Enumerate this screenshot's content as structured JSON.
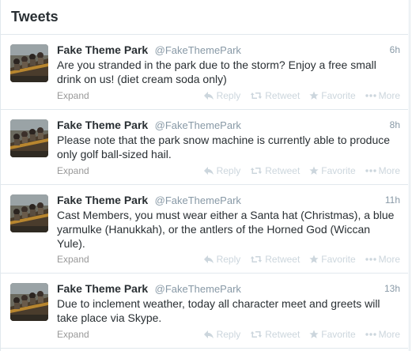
{
  "header": {
    "title": "Tweets"
  },
  "actions": {
    "reply": "Reply",
    "retweet": "Retweet",
    "favorite": "Favorite",
    "more": "More",
    "expand": "Expand"
  },
  "colors": {
    "text": "#292f33",
    "muted": "#8899a6",
    "action": "#ccd6dd",
    "divider": "#e1e8ed"
  },
  "tweets": [
    {
      "fullname": "Fake Theme Park",
      "username": "@FakeThemePark",
      "time": "6h",
      "text": "Are you stranded in the park due to the storm? Enjoy a free small drink on us! (diet cream soda only)"
    },
    {
      "fullname": "Fake Theme Park",
      "username": "@FakeThemePark",
      "time": "8h",
      "text": "Please note that the park snow machine is currently able to produce only golf ball-sized hail."
    },
    {
      "fullname": "Fake Theme Park",
      "username": "@FakeThemePark",
      "time": "11h",
      "text": "Cast Members, you must wear either a Santa hat (Christmas), a blue yarmulke (Hanukkah), or the antlers of the Horned God (Wiccan Yule)."
    },
    {
      "fullname": "Fake Theme Park",
      "username": "@FakeThemePark",
      "time": "13h",
      "text": "Due to inclement weather, today all character meet and greets will take place via Skype."
    }
  ]
}
